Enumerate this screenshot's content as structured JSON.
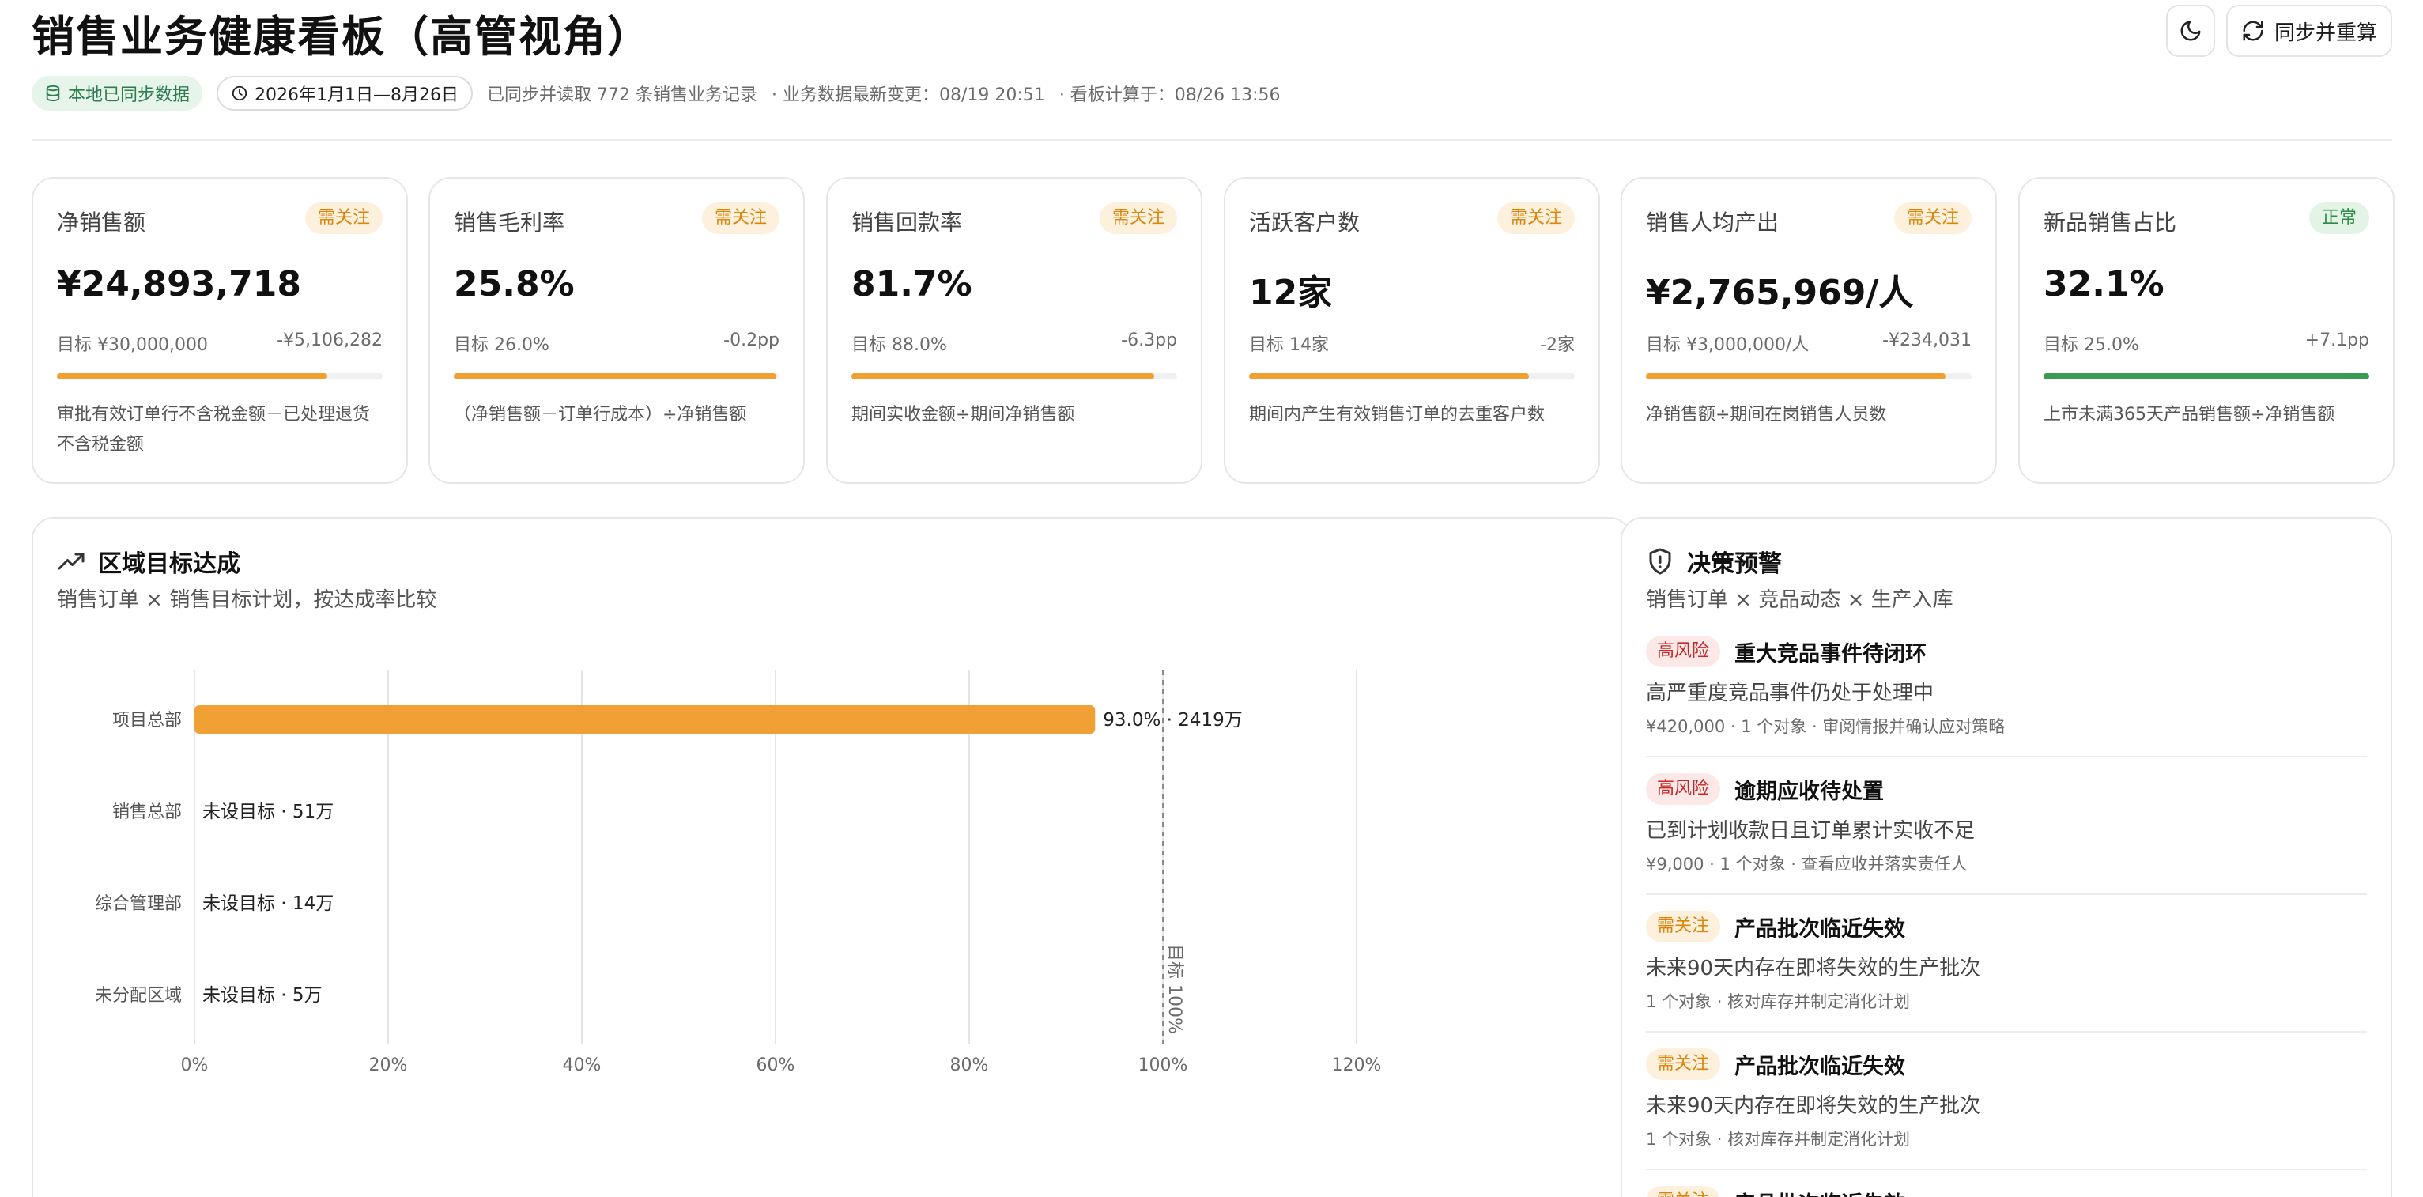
{
  "header": {
    "title": "销售业务健康看板（高管视角）",
    "sync_button_label": "同步并重算",
    "theme_icon": "moon-icon",
    "sync_icon": "refresh-icon"
  },
  "meta": {
    "local_synced_label": "本地已同步数据",
    "date_range": "2026年1月1日—8月26日",
    "records_text": "已同步并读取 772 条销售业务记录",
    "last_change_text": "· 业务数据最新变更：08/19 20:51",
    "computed_text": "· 看板计算于：08/26 13:56"
  },
  "colors": {
    "warn": "#f0a030",
    "ok": "#3a9b52",
    "bar": "#f0a035"
  },
  "kpis": [
    {
      "name": "净销售额",
      "badge": "需关注",
      "status": "warn",
      "value": "¥24,893,718",
      "target": "目标 ¥30,000,000",
      "delta": "-¥5,106,282",
      "progress": 0.83,
      "desc": "审批有效订单行不含税金额－已处理退货不含税金额"
    },
    {
      "name": "销售毛利率",
      "badge": "需关注",
      "status": "warn",
      "value": "25.8%",
      "target": "目标 26.0%",
      "delta": "-0.2pp",
      "progress": 0.99,
      "desc": "（净销售额－订单行成本）÷净销售额"
    },
    {
      "name": "销售回款率",
      "badge": "需关注",
      "status": "warn",
      "value": "81.7%",
      "target": "目标 88.0%",
      "delta": "-6.3pp",
      "progress": 0.93,
      "desc": "期间实收金额÷期间净销售额"
    },
    {
      "name": "活跃客户数",
      "badge": "需关注",
      "status": "warn",
      "value": "12家",
      "target": "目标 14家",
      "delta": "-2家",
      "progress": 0.86,
      "desc": "期间内产生有效销售订单的去重客户数"
    },
    {
      "name": "销售人均产出",
      "badge": "需关注",
      "status": "warn",
      "value": "¥2,765,969/人",
      "target": "目标 ¥3,000,000/人",
      "delta": "-¥234,031",
      "progress": 0.92,
      "desc": "净销售额÷期间在岗销售人员数"
    },
    {
      "name": "新品销售占比",
      "badge": "正常",
      "status": "ok",
      "value": "32.1%",
      "target": "目标 25.0%",
      "delta": "+7.1pp",
      "progress": 1.0,
      "desc": "上市未满365天产品销售额÷净销售额"
    }
  ],
  "region_panel": {
    "title": "区域目标达成",
    "subtitle": "销售订单 × 销售目标计划，按达成率比较",
    "icon": "trending-up-icon"
  },
  "chart_data": {
    "type": "bar",
    "orientation": "horizontal",
    "categories": [
      "项目总部",
      "销售总部",
      "综合管理部",
      "未分配区域"
    ],
    "values": [
      93.0,
      null,
      null,
      null
    ],
    "labels": [
      "93.0% · 2419万",
      "未设目标 · 51万",
      "未设目标 · 14万",
      "未设目标 · 5万"
    ],
    "xlim": [
      0,
      120
    ],
    "xticks": [
      "0%",
      "20%",
      "40%",
      "60%",
      "80%",
      "100%",
      "120%"
    ],
    "target_line": {
      "value": 100,
      "label": "目标 100%"
    },
    "grid": true
  },
  "alert_panel": {
    "title": "决策预警",
    "subtitle": "销售订单 × 竞品动态 × 生产入库",
    "icon": "shield-alert-icon",
    "items": [
      {
        "tag": "高风险",
        "level": "high",
        "title": "重大竞品事件待闭环",
        "desc": "高严重度竞品事件仍处于处理中",
        "foot": "¥420,000 · 1 个对象 · 审阅情报并确认应对策略"
      },
      {
        "tag": "高风险",
        "level": "high",
        "title": "逾期应收待处置",
        "desc": "已到计划收款日且订单累计实收不足",
        "foot": "¥9,000 · 1 个对象 · 查看应收并落实责任人"
      },
      {
        "tag": "需关注",
        "level": "warn",
        "title": "产品批次临近失效",
        "desc": "未来90天内存在即将失效的生产批次",
        "foot": "1 个对象 · 核对库存并制定消化计划"
      },
      {
        "tag": "需关注",
        "level": "warn",
        "title": "产品批次临近失效",
        "desc": "未来90天内存在即将失效的生产批次",
        "foot": "1 个对象 · 核对库存并制定消化计划"
      },
      {
        "tag": "需关注",
        "level": "warn",
        "title": "产品批次临近失效",
        "desc": "",
        "foot": ""
      }
    ]
  }
}
